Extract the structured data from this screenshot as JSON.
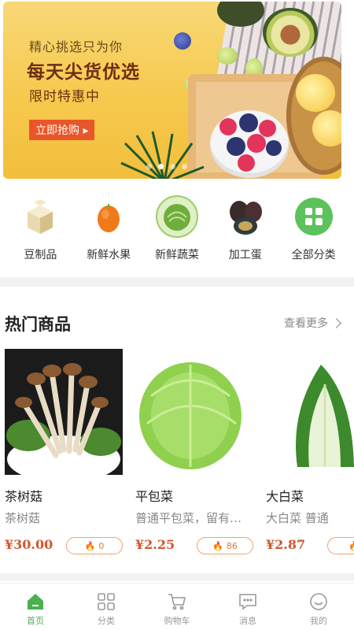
{
  "banner": {
    "line1": "精心挑选只为你",
    "line2": "每天尖货优选",
    "line3": "限时特惠中",
    "button_label": "立即抢购 ▸",
    "dot_count": 4,
    "active_dot": 1
  },
  "categories": [
    {
      "label": "豆制品",
      "icon": "tofu-icon"
    },
    {
      "label": "新鲜水果",
      "icon": "orange-icon"
    },
    {
      "label": "新鲜蔬菜",
      "icon": "cabbage-icon"
    },
    {
      "label": "加工蛋",
      "icon": "preserved-egg-icon"
    },
    {
      "label": "全部分类",
      "icon": "grid-icon"
    }
  ],
  "hot": {
    "title": "热门商品",
    "more_label": "查看更多",
    "products": [
      {
        "name": "茶树菇",
        "desc": "茶树菇",
        "price": "¥30.00",
        "heat": "0"
      },
      {
        "name": "平包菜",
        "desc": "普通平包菜，留有…",
        "price": "¥2.25",
        "heat": "86"
      },
      {
        "name": "大白菜",
        "desc": "大白菜 普通",
        "price": "¥2.87",
        "heat": ""
      }
    ]
  },
  "tabs": [
    {
      "label": "首页",
      "icon": "home-icon",
      "active": true
    },
    {
      "label": "分类",
      "icon": "category-grid-icon",
      "active": false
    },
    {
      "label": "购物车",
      "icon": "cart-icon",
      "active": false
    },
    {
      "label": "消息",
      "icon": "message-icon",
      "active": false
    },
    {
      "label": "我的",
      "icon": "profile-icon",
      "active": false
    }
  ],
  "colors": {
    "accent_green": "#4caf50",
    "price_red": "#d4542a",
    "banner_button": "#e8562a"
  }
}
